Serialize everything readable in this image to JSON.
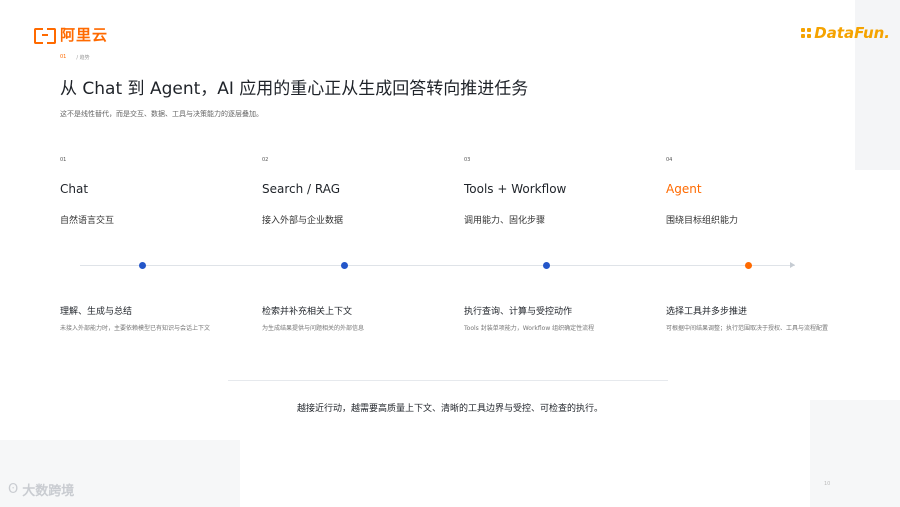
{
  "header": {
    "left_logo_text": "阿里云",
    "right_logo_text": "DataFun.",
    "breadcrumb": {
      "num": "01",
      "section": "/ 趋势"
    }
  },
  "title": "从 Chat 到 Agent，AI 应用的重心正从生成回答转向推进任务",
  "subtitle": "这不是线性替代，而是交互、数据、工具与决策能力的逐层叠加。",
  "stages": [
    {
      "num": "01",
      "name": "Chat",
      "desc": "自然语言交互",
      "cap_title": "理解、生成与总结",
      "cap_desc": "未接入外部能力时，主要依赖模型已有知识与会话上下文"
    },
    {
      "num": "02",
      "name": "Search / RAG",
      "desc": "接入外部与企业数据",
      "cap_title": "检索并补充相关上下文",
      "cap_desc": "为生成结果提供与问题相关的外部信息"
    },
    {
      "num": "03",
      "name": "Tools + Workflow",
      "desc": "调用能力、固化步骤",
      "cap_title": "执行查询、计算与受控动作",
      "cap_desc": "Tools 封装单项能力，Workflow 组织确定性流程"
    },
    {
      "num": "04",
      "name": "Agent",
      "desc": "围绕目标组织能力",
      "cap_title": "选择工具并多步推进",
      "cap_desc": "可根据中间结果调整；执行范围取决于授权、工具与流程配置"
    }
  ],
  "summary": "越接近行动，越需要高质量上下文、清晰的工具边界与受控、可检查的执行。",
  "watermark": {
    "text": "大数跨境"
  },
  "page_number": "10",
  "colors": {
    "accent": "#ff6a00",
    "node": "#2456c9",
    "datafun": "#f5a300"
  }
}
